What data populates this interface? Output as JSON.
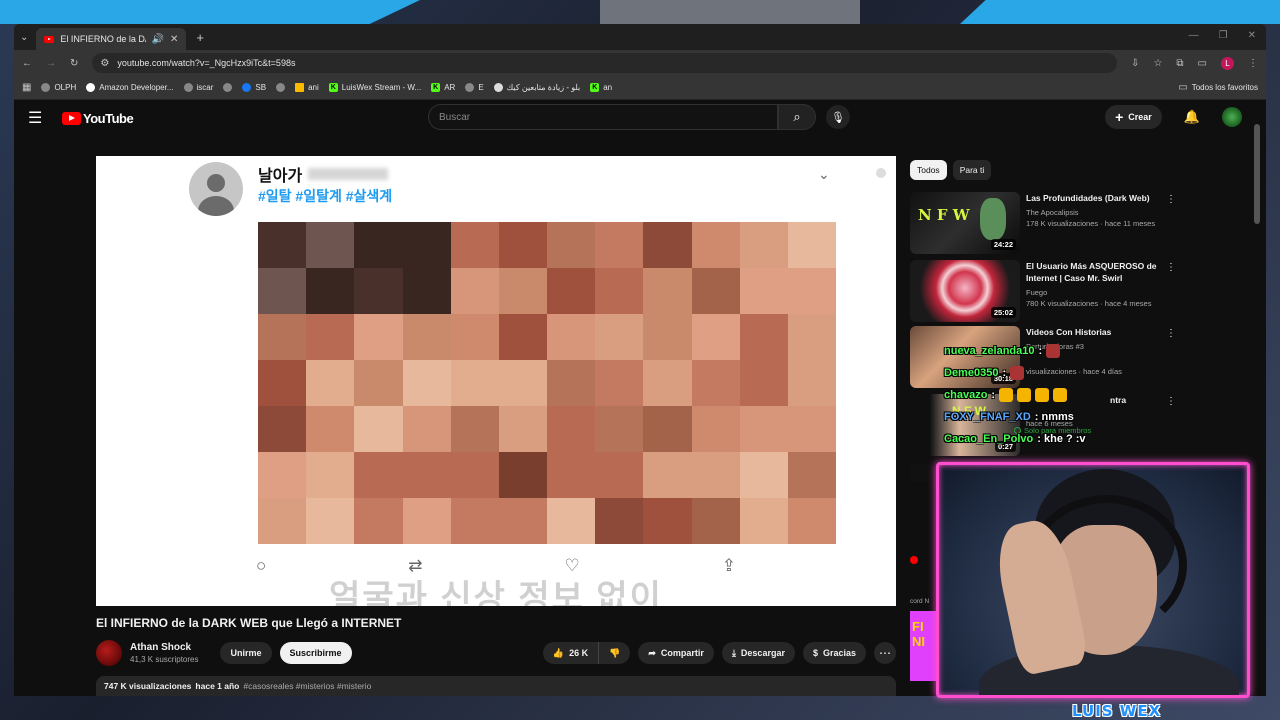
{
  "browser": {
    "tab_title": "El INFIERNO de la DARK WE",
    "url": "youtube.com/watch?v=_NgcHzx9iTc&t=598s",
    "bookmarks": [
      "OLPH",
      "Amazon Developer...",
      "iscar",
      "SB",
      "ani",
      "LuisWex Stream - W...",
      "AR",
      "E",
      "بلو - زيادة متابعين كيك",
      "an"
    ],
    "bookmarks_all": "Todos los favoritos",
    "profile_initial": "L"
  },
  "youtube": {
    "logo_text": "YouTube",
    "search_placeholder": "Buscar",
    "create_label": "Crear"
  },
  "video_frame": {
    "tweet_name": "날아가",
    "tweet_tags": "#일탈 #일탈계 #살색계",
    "subtitle": "얼굴과 신상 정보 없이"
  },
  "video": {
    "title": "El INFIERNO de la DARK WEB que Llegó a INTERNET",
    "channel": "Athan Shock",
    "subscribers": "41,3 K suscriptores",
    "join_label": "Unirme",
    "subscribe_label": "Suscribirme",
    "likes": "26 K",
    "share_label": "Compartir",
    "download_label": "Descargar",
    "thanks_label": "Gracias",
    "views": "747 K visualizaciones",
    "age": "hace 1 año",
    "hashtags": "#casosreales #misterios #misterio"
  },
  "sidebar": {
    "chips": [
      "Todos",
      "Para ti"
    ],
    "recommendations": [
      {
        "title": "Las Profundidades (Dark Web)",
        "channel": "The Apocalipsis",
        "meta": "178 K visualizaciones · hace 11 meses",
        "duration": "24:22"
      },
      {
        "title": "El Usuario Más ASQUEROSO de Internet | Caso Mr. Swirl",
        "channel": "Fuego",
        "meta": "780 K visualizaciones · hace 4 meses",
        "duration": "25:02"
      },
      {
        "title": "Videos Con Historias",
        "channel": "Perturbadoras #3",
        "meta": "visualizaciones · hace 4 días",
        "duration": "30:18"
      },
      {
        "title": "ntra",
        "channel": "",
        "meta": "hace 6 meses",
        "duration": "0:27"
      }
    ],
    "members_only": "Solo para miembros",
    "partial_text": "cord N"
  },
  "chat": [
    {
      "user": "nueva_zelanda10",
      "msg": ":"
    },
    {
      "user": "Deme0350",
      "msg": ":"
    },
    {
      "user": "chavazo",
      "msg": ":"
    },
    {
      "user": "FOXY_FNAF_XD",
      "msg": ": nmms"
    },
    {
      "user": "Cacao_En_Polvo",
      "msg": ": khe ? :v"
    }
  ],
  "streamer": {
    "watermark": "LUIS WEX"
  },
  "colors": {
    "accent_red": "#ff0000",
    "webcam_border": "#ff4fcf",
    "chat_user": "#48ff55",
    "link_blue": "#1d9bf0"
  }
}
